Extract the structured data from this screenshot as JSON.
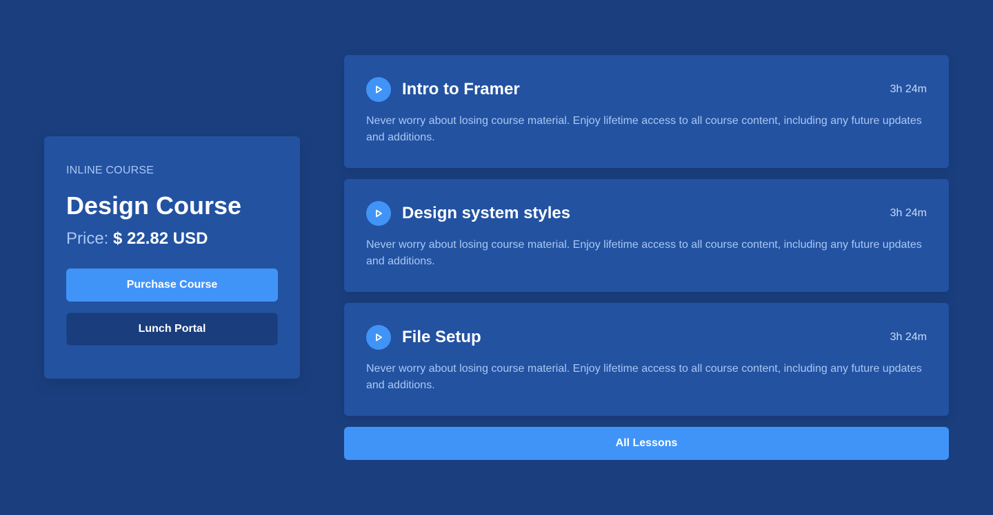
{
  "course_card": {
    "eyebrow": "INLINE COURSE",
    "title": "Design Course",
    "price_label": "Price:",
    "price_value": "$ 22.82 USD",
    "purchase_label": "Purchase Course",
    "portal_label": "Lunch Portal"
  },
  "lessons": [
    {
      "title": "Intro to Framer",
      "duration": "3h 24m",
      "description": "Never worry about losing course material. Enjoy lifetime access to all course content, including any future updates and additions.",
      "icon": "play-icon"
    },
    {
      "title": "Design system styles",
      "duration": "3h 24m",
      "description": "Never worry about losing course material. Enjoy lifetime access to all course content, including any future updates and additions.",
      "icon": "play-icon"
    },
    {
      "title": "File Setup",
      "duration": "3h 24m",
      "description": "Never worry about losing course material. Enjoy lifetime access to all course content, including any future updates and additions.",
      "icon": "play-icon"
    }
  ],
  "all_lessons_label": "All Lessons",
  "colors": {
    "background": "#1b3f7e",
    "card": "#2352a1",
    "accent": "#4194f7",
    "secondary_button": "#1a3e7d",
    "muted_text": "#a9c8f4"
  }
}
